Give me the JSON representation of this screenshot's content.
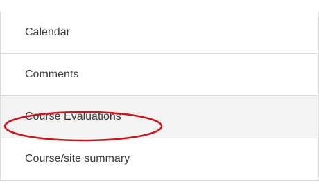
{
  "menu": {
    "items": [
      {
        "label": "Calendar"
      },
      {
        "label": "Comments"
      },
      {
        "label": "Course Evaluations"
      },
      {
        "label": "Course/site summary"
      }
    ]
  },
  "annotation": {
    "color": "#d0121b"
  }
}
